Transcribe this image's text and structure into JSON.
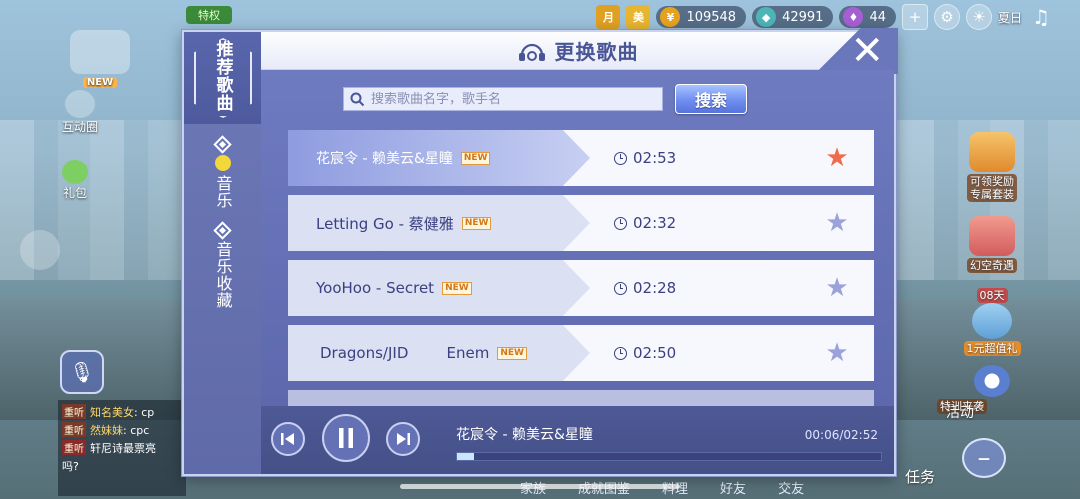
{
  "hud": {
    "left_badge": "特权",
    "gold": "109548",
    "gems": "42991",
    "diamonds": "44",
    "label_rank": "月",
    "label_mascot": "美",
    "weather": "夏日"
  },
  "left_widgets": {
    "new_badge": "NEW",
    "interaction": "互动圈",
    "gift": "礼包"
  },
  "chat": [
    {
      "tag": "重听",
      "user": "知名美女",
      "text": ": cp"
    },
    {
      "tag": "重听",
      "user": "然妹妹",
      "text": ": cpc"
    },
    {
      "tag": "重听",
      "user": "轩尼诗最票亮",
      "text": ""
    },
    {
      "tag": "",
      "user": "",
      "text": "吗?"
    }
  ],
  "right_widgets": {
    "reward": "可领奖励\n专属套装",
    "fantasy": "幻空奇遇",
    "days": "08天",
    "deal": "1元超值礼",
    "training": "特训来袭",
    "activity": "活动",
    "task": "任务"
  },
  "bottom_nav": [
    "家族",
    "成就图鉴",
    "料理",
    "好友",
    "交友"
  ],
  "dialog": {
    "title": "更换歌曲",
    "tabs": [
      {
        "label": "推荐歌曲",
        "active": true
      },
      {
        "label": "音乐",
        "active": false
      },
      {
        "label": "音乐收藏",
        "active": false
      }
    ],
    "search": {
      "placeholder": "搜索歌曲名字，歌手名",
      "button": "搜索"
    },
    "songs": [
      {
        "title": "花宸令 - 赖美云&星瞳",
        "badge": "NEW",
        "duration": "02:53",
        "favorite": true,
        "playing": true
      },
      {
        "title": "Letting Go - 蔡健雅",
        "badge": "NEW",
        "duration": "02:32",
        "favorite": false,
        "playing": false
      },
      {
        "title": "YooHoo - Secret",
        "badge": "NEW",
        "duration": "02:28",
        "favorite": false,
        "playing": false
      },
      {
        "title": "Dragons/JID        Enem",
        "badge": "NEW",
        "duration": "02:50",
        "favorite": false,
        "playing": false
      }
    ],
    "player": {
      "now_playing": "花宸令 - 赖美云&星瞳",
      "elapsed_total": "00:06/02:52",
      "progress": 0.04
    }
  },
  "colors": {
    "accent": "#5d68ad",
    "favorite_star": "#f06a4c",
    "inactive_star": "#9aa2d9",
    "title_text": "#4a5596"
  }
}
